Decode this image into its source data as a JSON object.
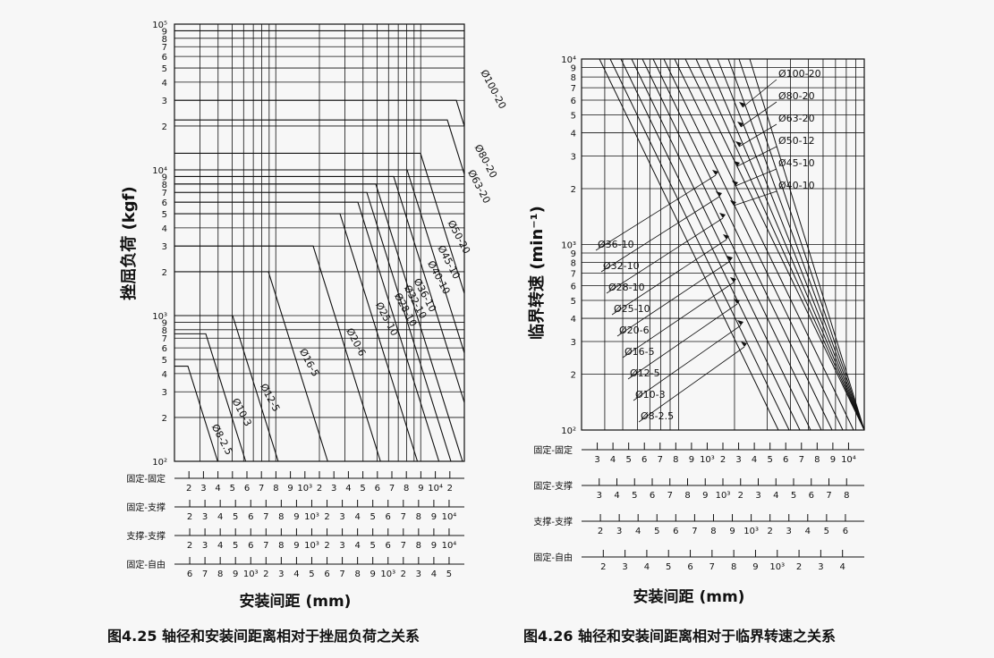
{
  "chart_data": [
    {
      "type": "line",
      "title": "",
      "caption": "图4.25 轴径和安装间距离相对于挫屈负荷之关系",
      "ylabel": "挫屈负荷 (kgf)",
      "xlabel": "安装间距 (mm)",
      "yscale": "log",
      "ylim": [
        100,
        100000
      ],
      "y_tick_labels": [
        "10²",
        "2",
        "3",
        "4",
        "5",
        "6",
        "7",
        "8",
        "9",
        "10³",
        "2",
        "3",
        "4",
        "5",
        "6",
        "7",
        "8",
        "9",
        "10⁴",
        "2",
        "3",
        "4",
        "5",
        "6",
        "7",
        "8",
        "9",
        "10⁵"
      ],
      "mount_scales": [
        {
          "label": "固定-固定",
          "ticks": [
            "2",
            "3",
            "4",
            "5",
            "6",
            "7",
            "8",
            "9",
            "10³",
            "2",
            "3",
            "4",
            "5",
            "6",
            "7",
            "8",
            "9",
            "10⁴",
            "2"
          ]
        },
        {
          "label": "固定-支撑",
          "ticks": [
            "2",
            "3",
            "4",
            "5",
            "6",
            "7",
            "8",
            "9",
            "10³",
            "2",
            "3",
            "4",
            "5",
            "6",
            "7",
            "8",
            "9",
            "10⁴"
          ]
        },
        {
          "label": "支撑-支撑",
          "ticks": [
            "2",
            "3",
            "4",
            "5",
            "6",
            "7",
            "8",
            "9",
            "10³",
            "2",
            "3",
            "4",
            "5",
            "6",
            "7",
            "8",
            "9",
            "10⁴"
          ]
        },
        {
          "label": "固定-自由",
          "ticks": [
            "6",
            "7",
            "8",
            "9",
            "10³",
            "2",
            "3",
            "4",
            "5",
            "6",
            "7",
            "8",
            "9",
            "10³",
            "2",
            "3",
            "4",
            "5"
          ]
        }
      ],
      "series": [
        {
          "name": "Ø8-2.5",
          "plateau": 450,
          "x_break": 210,
          "x_end": 260
        },
        {
          "name": "Ø10-3",
          "plateau": 750,
          "x_break": 230,
          "x_end": 290
        },
        {
          "name": "Ø12-5",
          "plateau": 1000,
          "x_break": 260,
          "x_end": 330
        },
        {
          "name": "Ø16-5",
          "plateau": 2000,
          "x_break": 300,
          "x_end": 405
        },
        {
          "name": "Ø20-6",
          "plateau": 3000,
          "x_break": 350,
          "x_end": 460
        },
        {
          "name": "Ø25-10",
          "plateau": 5000,
          "x_break": 380,
          "x_end": 505
        },
        {
          "name": "Ø28-10",
          "plateau": 6000,
          "x_break": 400,
          "x_end": 520
        },
        {
          "name": "Ø32-10",
          "plateau": 7000,
          "x_break": 410,
          "x_end": 520
        },
        {
          "name": "Ø36-10",
          "plateau": 8000,
          "x_break": 420,
          "x_end": 520
        },
        {
          "name": "Ø40-10",
          "plateau": 9000,
          "x_break": 440,
          "x_end": 520
        },
        {
          "name": "Ø45-10",
          "plateau": 10000,
          "x_break": 455,
          "x_end": 520
        },
        {
          "name": "Ø50-20",
          "plateau": 13000,
          "x_break": 470,
          "x_end": 520
        },
        {
          "name": "Ø63-20",
          "plateau": 22000,
          "x_break": 500,
          "x_end": 520
        },
        {
          "name": "Ø80-20",
          "plateau": 30000,
          "x_break": 510,
          "x_end": 520
        },
        {
          "name": "Ø100-20",
          "plateau": 90000,
          "x_break": 520,
          "x_end": 520
        }
      ]
    },
    {
      "type": "line",
      "title": "",
      "caption": "图4.26 轴径和安装间距离相对于临界转速之关系",
      "ylabel": "临界转速 (min⁻¹)",
      "xlabel": "安装间距 (mm)",
      "yscale": "log",
      "ylim": [
        100,
        10000
      ],
      "y_tick_labels": [
        "10²",
        "2",
        "3",
        "4",
        "5",
        "6",
        "7",
        "8",
        "9",
        "10³",
        "2",
        "3",
        "4",
        "5",
        "6",
        "7",
        "8",
        "9",
        "10⁴"
      ],
      "mount_scales": [
        {
          "label": "固定-固定",
          "ticks": [
            "3",
            "4",
            "5",
            "6",
            "7",
            "8",
            "9",
            "10³",
            "2",
            "3",
            "4",
            "5",
            "6",
            "7",
            "8",
            "9",
            "10⁴"
          ]
        },
        {
          "label": "固定-支撑",
          "ticks": [
            "3",
            "4",
            "5",
            "6",
            "7",
            "8",
            "9",
            "10³",
            "2",
            "3",
            "4",
            "5",
            "6",
            "7",
            "8"
          ]
        },
        {
          "label": "支撑-支撑",
          "ticks": [
            "2",
            "3",
            "4",
            "5",
            "6",
            "7",
            "8",
            "9",
            "10³",
            "2",
            "3",
            "4",
            "5",
            "6"
          ]
        },
        {
          "label": "固定-自由",
          "ticks": [
            "2",
            "3",
            "4",
            "5",
            "6",
            "7",
            "8",
            "9",
            "10³",
            "2",
            "3",
            "4"
          ]
        }
      ],
      "series": [
        {
          "name": "Ø100-20"
        },
        {
          "name": "Ø80-20"
        },
        {
          "name": "Ø63-20"
        },
        {
          "name": "Ø50-12"
        },
        {
          "name": "Ø45-10"
        },
        {
          "name": "Ø40-10"
        },
        {
          "name": "Ø36-10"
        },
        {
          "name": "Ø32-10"
        },
        {
          "name": "Ø28-10"
        },
        {
          "name": "Ø25-10"
        },
        {
          "name": "Ø20-6"
        },
        {
          "name": "Ø16-5"
        },
        {
          "name": "Ø12-5"
        },
        {
          "name": "Ø10-3"
        },
        {
          "name": "Ø8-2.5"
        }
      ]
    }
  ]
}
